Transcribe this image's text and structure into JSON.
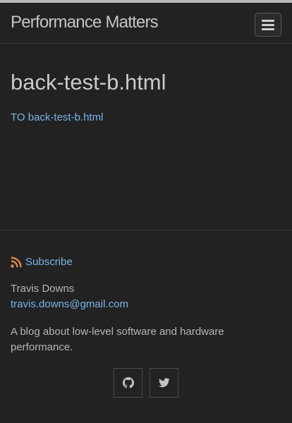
{
  "site": {
    "title": "Performance Matters"
  },
  "nav": {
    "menu_icon": "hamburger-menu-icon"
  },
  "post": {
    "title": "back-test-b.html",
    "link_text": "TO back-test-b.html"
  },
  "footer": {
    "subscribe_label": "Subscribe",
    "subscribe_icon": "rss-icon",
    "author_name": "Travis Downs",
    "email": "travis.downs@gmail.com",
    "description": "A blog about low-level software and hardware performance.",
    "social": [
      {
        "icon": "github-icon"
      },
      {
        "icon": "twitter-icon"
      }
    ]
  },
  "colors": {
    "background": "#222222",
    "link": "#7ab3e8",
    "text": "#b5b5b5",
    "title": "#c9c9c9",
    "rss": "#e0894a"
  }
}
